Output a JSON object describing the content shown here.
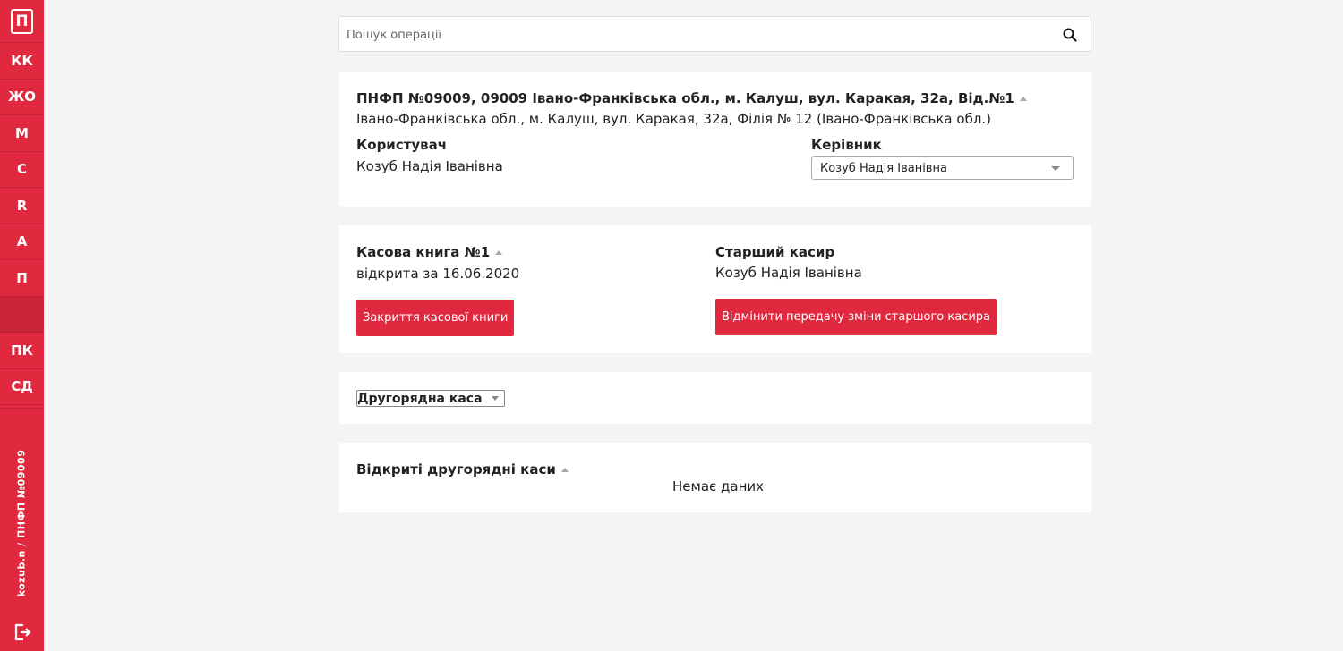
{
  "sidebar": {
    "logo": "П",
    "items": [
      "КК",
      "ЖО",
      "М",
      "С",
      "R",
      "А",
      "П"
    ],
    "items2": [
      "ПК",
      "СД"
    ],
    "user_info": "kozub.n / ПНФП №09009",
    "exit_icon": "exit-icon"
  },
  "search": {
    "placeholder": "Пошук операції",
    "value": "",
    "icon": "search-icon"
  },
  "branch": {
    "title": "ПНФП №09009, 09009 Івано-Франківська обл., м. Калуш, вул. Каракая, 32а, Від.№1",
    "address": "Івано-Франківська обл., м. Калуш, вул. Каракая, 32а, Філія № 12 (Івано-Франківська обл.)",
    "user_label": "Користувач",
    "user_value": "Козуб Надія Іванівна",
    "manager_label": "Керівник",
    "manager_selected": "Козуб Надія Іванівна"
  },
  "cashbook": {
    "title": "Касова книга №1",
    "status": "відкрита за 16.06.2020",
    "close_button": "Закриття касової книги",
    "senior_label": "Старший касир",
    "senior_value": "Козуб Надія Іванівна",
    "cancel_button": "Відмінити передачу зміни старшого касира"
  },
  "secondary": {
    "label": "Другорядна каса"
  },
  "open_secondary": {
    "title": "Відкриті другорядні каси",
    "empty": "Немає даних"
  },
  "colors": {
    "accent": "#e0283f",
    "background": "#f4f4f4"
  }
}
